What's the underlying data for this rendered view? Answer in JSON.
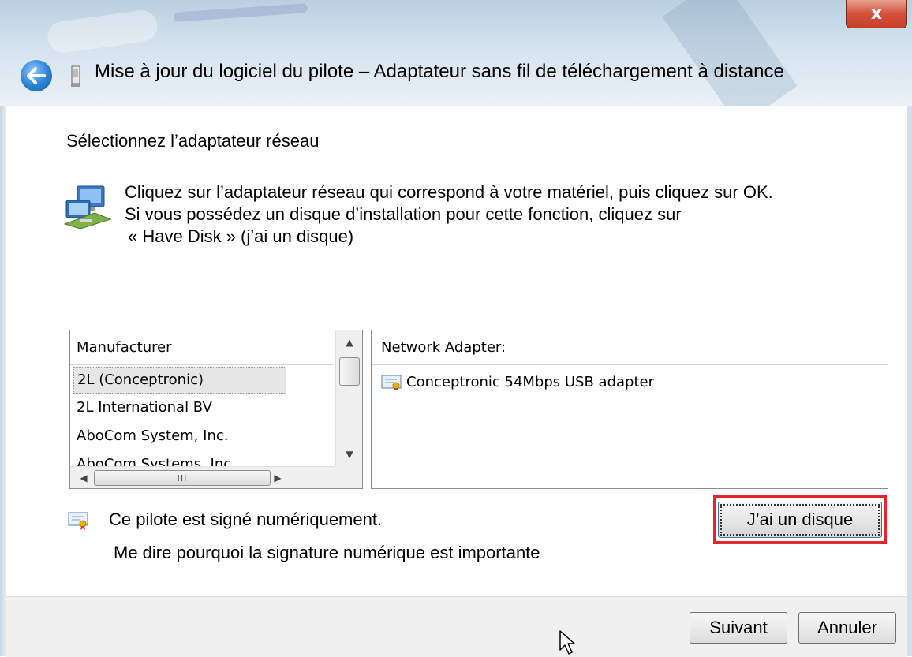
{
  "window": {
    "title": "Mise à jour du logiciel du pilote – Adaptateur sans fil de téléchargement à distance",
    "close_glyph": "x",
    "back_icon": "back-arrow-icon"
  },
  "main": {
    "heading": "Sélectionnez l’adaptateur réseau",
    "instructions": [
      "Cliquez sur l’adaptateur réseau qui correspond à votre matériel, puis cliquez sur OK.",
      "Si vous possédez un disque d’installation pour cette fonction, cliquez sur",
      "« Have Disk » (j’ai un disque)"
    ]
  },
  "manufacturer_list": {
    "header": "Manufacturer",
    "items": [
      "2L (Conceptronic)",
      "2L International BV",
      "AboCom System, Inc.",
      "AboCom Systems, Inc."
    ],
    "selected": "2L (Conceptronic)",
    "hscroll_thumb_glyph": "III"
  },
  "adapter_list": {
    "header": "Network Adapter:",
    "items": [
      "Conceptronic 54Mbps USB adapter"
    ]
  },
  "signature": {
    "status": "Ce pilote est signé numériquement.",
    "link": "Me dire pourquoi la signature numérique est importante"
  },
  "buttons": {
    "have_disk": "J’ai un disque",
    "next": "Suivant",
    "cancel": "Annuler"
  },
  "colors": {
    "highlight": "#e8242c",
    "title_gradient_top": "#b9cfe0",
    "footer": "#f0f0f0"
  }
}
